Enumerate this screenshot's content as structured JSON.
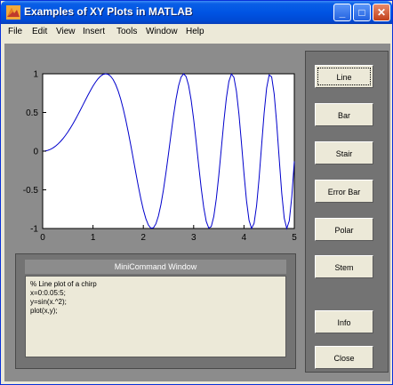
{
  "window": {
    "title": "Examples of XY Plots in MATLAB",
    "minimize_glyph": "_",
    "maximize_glyph": "□",
    "close_glyph": "✕"
  },
  "menu": [
    "File",
    "Edit",
    "View",
    "Insert",
    "Tools",
    "Window",
    "Help"
  ],
  "buttons": [
    "Line",
    "Bar",
    "Stair",
    "Error Bar",
    "Polar",
    "Stem",
    "Info",
    "Close"
  ],
  "selected_button": "Line",
  "command_window": {
    "title": "MiniCommand Window",
    "lines": [
      "% Line plot of a chirp",
      "x=0:0.05:5;",
      "y=sin(x.^2);",
      "plot(x,y);"
    ]
  },
  "chart_data": {
    "type": "line",
    "function": "y=sin(x.^2)",
    "x_range": [
      0,
      5
    ],
    "x_step": 0.05,
    "xlim": [
      0,
      5
    ],
    "ylim": [
      -1,
      1
    ],
    "xticks": [
      0,
      1,
      2,
      3,
      4,
      5
    ],
    "yticks": [
      -1,
      -0.5,
      0,
      0.5,
      1
    ],
    "ytick_labels": [
      "-1",
      "-0.5",
      "0",
      "0.5",
      "1"
    ],
    "line_color": "#0000cc",
    "grid": false
  },
  "colors": {
    "figure_bg": "#8c8c8c",
    "axes_bg": "#ffffff",
    "titlebar": "#0054e3"
  }
}
